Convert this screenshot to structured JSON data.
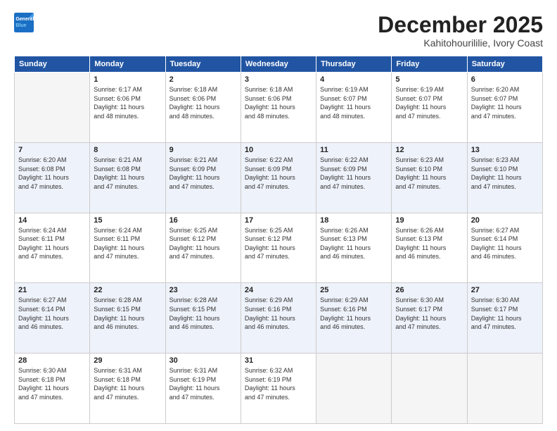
{
  "header": {
    "logo_line1": "General",
    "logo_line2": "Blue",
    "month": "December 2025",
    "location": "Kahitohourililie, Ivory Coast"
  },
  "weekdays": [
    "Sunday",
    "Monday",
    "Tuesday",
    "Wednesday",
    "Thursday",
    "Friday",
    "Saturday"
  ],
  "weeks": [
    [
      {
        "day": "",
        "empty": true
      },
      {
        "day": "1",
        "sunrise": "6:17 AM",
        "sunset": "6:06 PM",
        "daylight": "11 hours and 48 minutes."
      },
      {
        "day": "2",
        "sunrise": "6:18 AM",
        "sunset": "6:06 PM",
        "daylight": "11 hours and 48 minutes."
      },
      {
        "day": "3",
        "sunrise": "6:18 AM",
        "sunset": "6:06 PM",
        "daylight": "11 hours and 48 minutes."
      },
      {
        "day": "4",
        "sunrise": "6:19 AM",
        "sunset": "6:07 PM",
        "daylight": "11 hours and 48 minutes."
      },
      {
        "day": "5",
        "sunrise": "6:19 AM",
        "sunset": "6:07 PM",
        "daylight": "11 hours and 47 minutes."
      },
      {
        "day": "6",
        "sunrise": "6:20 AM",
        "sunset": "6:07 PM",
        "daylight": "11 hours and 47 minutes."
      }
    ],
    [
      {
        "day": "7",
        "sunrise": "6:20 AM",
        "sunset": "6:08 PM",
        "daylight": "11 hours and 47 minutes."
      },
      {
        "day": "8",
        "sunrise": "6:21 AM",
        "sunset": "6:08 PM",
        "daylight": "11 hours and 47 minutes."
      },
      {
        "day": "9",
        "sunrise": "6:21 AM",
        "sunset": "6:09 PM",
        "daylight": "11 hours and 47 minutes."
      },
      {
        "day": "10",
        "sunrise": "6:22 AM",
        "sunset": "6:09 PM",
        "daylight": "11 hours and 47 minutes."
      },
      {
        "day": "11",
        "sunrise": "6:22 AM",
        "sunset": "6:09 PM",
        "daylight": "11 hours and 47 minutes."
      },
      {
        "day": "12",
        "sunrise": "6:23 AM",
        "sunset": "6:10 PM",
        "daylight": "11 hours and 47 minutes."
      },
      {
        "day": "13",
        "sunrise": "6:23 AM",
        "sunset": "6:10 PM",
        "daylight": "11 hours and 47 minutes."
      }
    ],
    [
      {
        "day": "14",
        "sunrise": "6:24 AM",
        "sunset": "6:11 PM",
        "daylight": "11 hours and 47 minutes."
      },
      {
        "day": "15",
        "sunrise": "6:24 AM",
        "sunset": "6:11 PM",
        "daylight": "11 hours and 47 minutes."
      },
      {
        "day": "16",
        "sunrise": "6:25 AM",
        "sunset": "6:12 PM",
        "daylight": "11 hours and 47 minutes."
      },
      {
        "day": "17",
        "sunrise": "6:25 AM",
        "sunset": "6:12 PM",
        "daylight": "11 hours and 47 minutes."
      },
      {
        "day": "18",
        "sunrise": "6:26 AM",
        "sunset": "6:13 PM",
        "daylight": "11 hours and 46 minutes."
      },
      {
        "day": "19",
        "sunrise": "6:26 AM",
        "sunset": "6:13 PM",
        "daylight": "11 hours and 46 minutes."
      },
      {
        "day": "20",
        "sunrise": "6:27 AM",
        "sunset": "6:14 PM",
        "daylight": "11 hours and 46 minutes."
      }
    ],
    [
      {
        "day": "21",
        "sunrise": "6:27 AM",
        "sunset": "6:14 PM",
        "daylight": "11 hours and 46 minutes."
      },
      {
        "day": "22",
        "sunrise": "6:28 AM",
        "sunset": "6:15 PM",
        "daylight": "11 hours and 46 minutes."
      },
      {
        "day": "23",
        "sunrise": "6:28 AM",
        "sunset": "6:15 PM",
        "daylight": "11 hours and 46 minutes."
      },
      {
        "day": "24",
        "sunrise": "6:29 AM",
        "sunset": "6:16 PM",
        "daylight": "11 hours and 46 minutes."
      },
      {
        "day": "25",
        "sunrise": "6:29 AM",
        "sunset": "6:16 PM",
        "daylight": "11 hours and 46 minutes."
      },
      {
        "day": "26",
        "sunrise": "6:30 AM",
        "sunset": "6:17 PM",
        "daylight": "11 hours and 47 minutes."
      },
      {
        "day": "27",
        "sunrise": "6:30 AM",
        "sunset": "6:17 PM",
        "daylight": "11 hours and 47 minutes."
      }
    ],
    [
      {
        "day": "28",
        "sunrise": "6:30 AM",
        "sunset": "6:18 PM",
        "daylight": "11 hours and 47 minutes."
      },
      {
        "day": "29",
        "sunrise": "6:31 AM",
        "sunset": "6:18 PM",
        "daylight": "11 hours and 47 minutes."
      },
      {
        "day": "30",
        "sunrise": "6:31 AM",
        "sunset": "6:19 PM",
        "daylight": "11 hours and 47 minutes."
      },
      {
        "day": "31",
        "sunrise": "6:32 AM",
        "sunset": "6:19 PM",
        "daylight": "11 hours and 47 minutes."
      },
      {
        "day": "",
        "empty": true
      },
      {
        "day": "",
        "empty": true
      },
      {
        "day": "",
        "empty": true
      }
    ]
  ],
  "labels": {
    "sunrise": "Sunrise:",
    "sunset": "Sunset:",
    "daylight": "Daylight:"
  }
}
